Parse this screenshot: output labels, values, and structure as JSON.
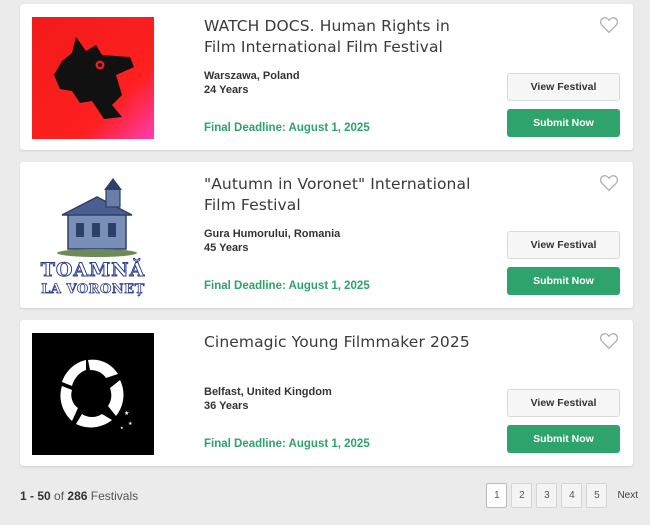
{
  "festivals": [
    {
      "title": "WATCH DOCS. Human Rights in Film International Film Festival",
      "location": "Warszawa, Poland",
      "years": "24 Years",
      "deadline": "Final Deadline: August 1, 2025",
      "view_label": "View Festival",
      "submit_label": "Submit Now"
    },
    {
      "title": "\"Autumn in Voronet\" International Film Festival",
      "location": "Gura Humorului, Romania",
      "years": "45 Years",
      "deadline": "Final Deadline: August 1, 2025",
      "view_label": "View Festival",
      "submit_label": "Submit Now",
      "logo_text_line1": "TOAMNĂ",
      "logo_text_line2": "LA VORONEȚ"
    },
    {
      "title": "Cinemagic Young Filmmaker 2025",
      "location": "Belfast, United Kingdom",
      "years": "36 Years",
      "deadline": "Final Deadline: August 1, 2025",
      "view_label": "View Festival",
      "submit_label": "Submit Now"
    }
  ],
  "footer": {
    "range": "1 - 50",
    "of_word": "of",
    "total": "286",
    "unit": "Festivals"
  },
  "pagination": {
    "pages": [
      "1",
      "2",
      "3",
      "4",
      "5"
    ],
    "current": "1",
    "next_label": "Next"
  },
  "colors": {
    "accent_green": "#2ea36b",
    "background": "#ebebeb"
  },
  "icons": {
    "favorite": "heart-outline-icon"
  }
}
